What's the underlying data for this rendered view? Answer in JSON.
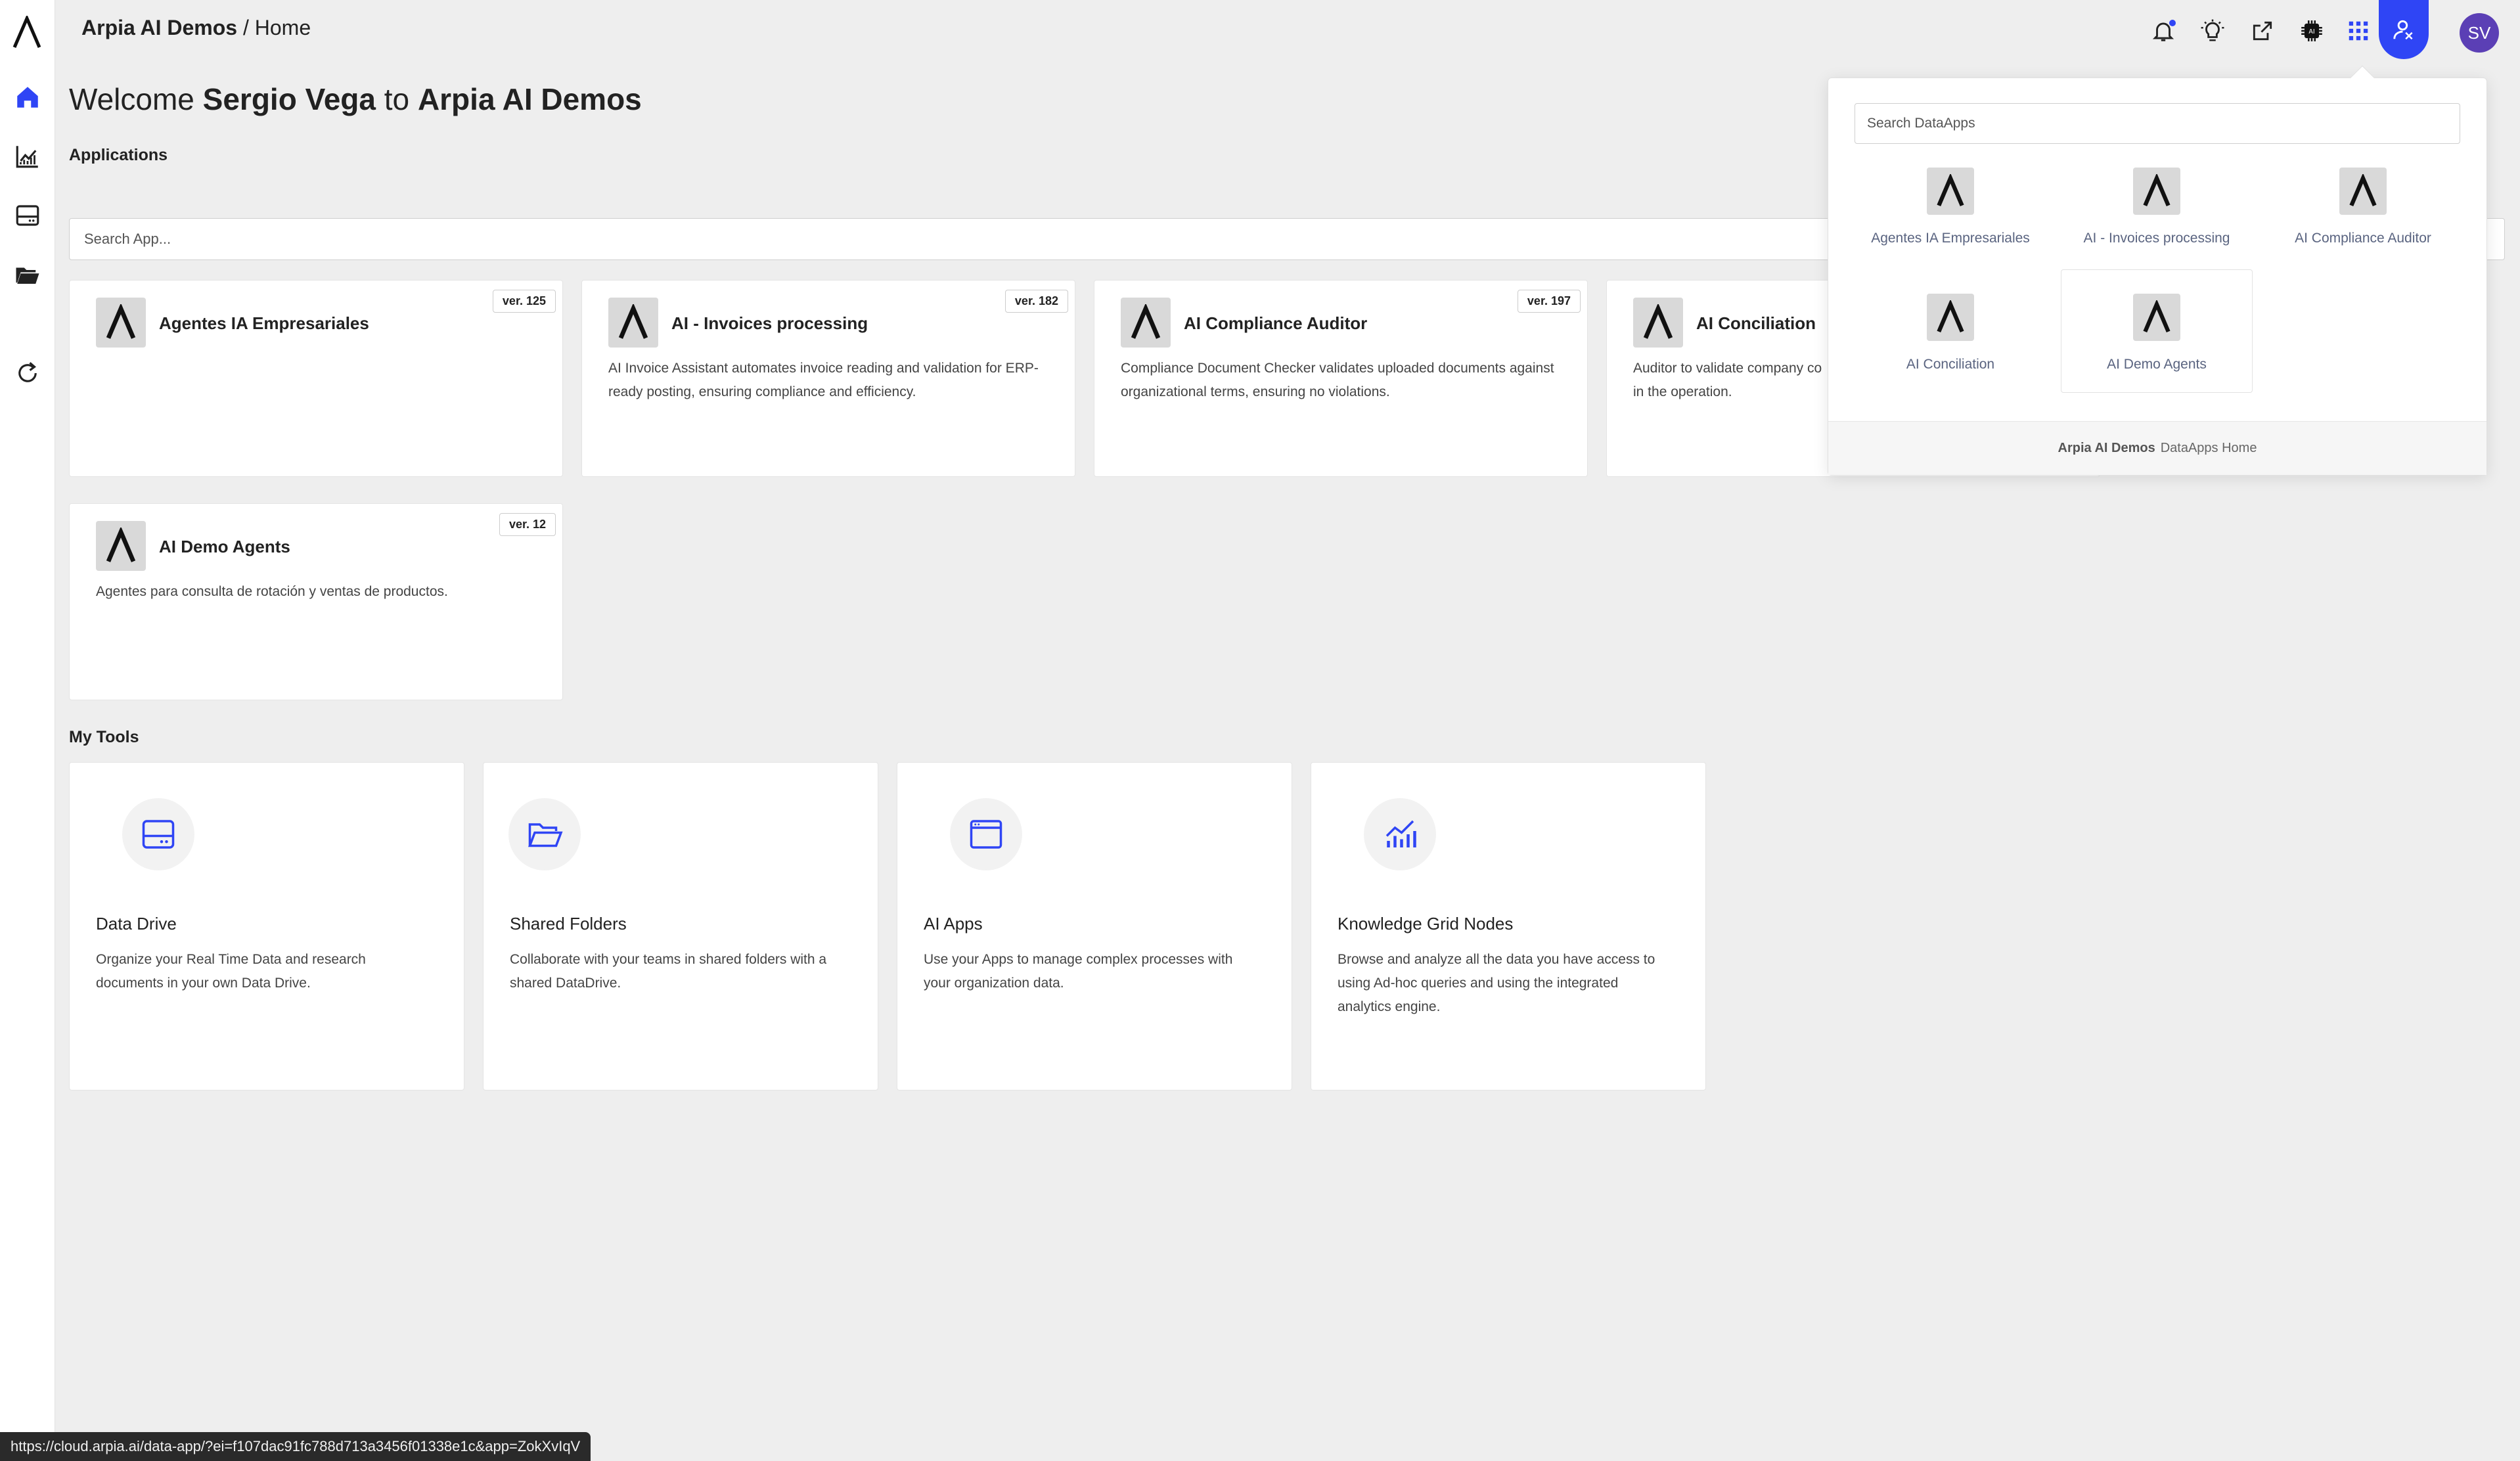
{
  "header": {
    "org": "Arpia AI Demos",
    "separator": " / ",
    "page": "Home",
    "avatar_initials": "SV"
  },
  "welcome": {
    "prefix": "Welcome ",
    "user": "Sergio Vega",
    "middle": " to ",
    "org": "Arpia AI Demos"
  },
  "sections": {
    "applications": "Applications",
    "my_tools": "My Tools"
  },
  "search": {
    "app_placeholder": "Search App...",
    "dataapps_placeholder": "Search DataApps"
  },
  "apps": [
    {
      "title": "Agentes IA Empresariales",
      "version": "ver. 125",
      "desc": ""
    },
    {
      "title": "AI - Invoices processing",
      "version": "ver. 182",
      "desc": "AI Invoice Assistant automates invoice reading and validation for ERP-ready posting, ensuring compliance and efficiency."
    },
    {
      "title": "AI Compliance Auditor",
      "version": "ver. 197",
      "desc": "Compliance Document Checker validates uploaded documents against organizational terms, ensuring no violations."
    },
    {
      "title": "AI Conciliation",
      "version": "",
      "desc": "Auditor to validate company co in the operation."
    },
    {
      "title": "AI Demo Agents",
      "version": "ver. 12",
      "desc": "Agentes para consulta de rotación y ventas de productos."
    }
  ],
  "tools": [
    {
      "title": "Data Drive",
      "desc": "Organize your Real Time Data and research documents in your own Data Drive."
    },
    {
      "title": "Shared Folders",
      "desc": "Collaborate with your teams in shared folders with a shared DataDrive."
    },
    {
      "title": "AI Apps",
      "desc": "Use your Apps to manage complex processes with your organization data."
    },
    {
      "title": "Knowledge Grid Nodes",
      "desc": "Browse and analyze all the data you have access to using Ad-hoc queries and using the integrated analytics engine."
    }
  ],
  "dataapps": {
    "items": [
      "Agentes IA Empresariales",
      "AI - Invoices processing",
      "AI Compliance Auditor",
      "AI Conciliation",
      "AI Demo Agents"
    ],
    "footer_org": "Arpia AI Demos",
    "footer_link": "DataApps Home"
  },
  "status_url": "https://cloud.arpia.ai/data-app/?ei=f107dac91fc788d713a3456f01338e1c&app=ZokXvIqV",
  "colors": {
    "accent": "#2f45f5",
    "avatar": "#5b3fb5",
    "background": "#eeeeee"
  }
}
